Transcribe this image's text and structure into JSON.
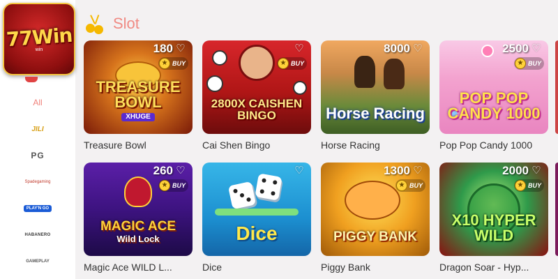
{
  "sidebar": {
    "logo_text": "77Win",
    "logo_sub": "win",
    "items": [
      {
        "label": "All",
        "name": "sidebar-item-all"
      },
      {
        "label": "JILI",
        "name": "sidebar-item-jili"
      },
      {
        "label": "PG",
        "name": "sidebar-item-pg"
      },
      {
        "label": "Spadegaming",
        "name": "sidebar-item-spadegaming"
      },
      {
        "label": "PLAY'N GO",
        "name": "sidebar-item-playngo"
      },
      {
        "label": "HABANERO",
        "name": "sidebar-item-habanero"
      },
      {
        "label": "GAMEPLAY",
        "name": "sidebar-item-gameplay"
      }
    ]
  },
  "header": {
    "title": "Slot",
    "icon": "cherry-icon"
  },
  "buy_label": "BUY",
  "games": [
    {
      "name": "Treasure Bowl",
      "count": "180",
      "art_title": "TREASURE BOWL",
      "art_sub": "XHUGE",
      "buy": true
    },
    {
      "name": "Cai Shen Bingo",
      "count": "",
      "art_title": "2800X CAISHEN BINGO",
      "art_sub": "",
      "buy": true
    },
    {
      "name": "Horse Racing",
      "count": "8000",
      "art_title": "Horse Racing",
      "art_sub": "",
      "buy": false
    },
    {
      "name": "Pop Pop Candy 1000",
      "count": "2500",
      "art_title": "POP POP CANDY 1000",
      "art_sub": "",
      "buy": true
    },
    {
      "name": "Magic Ace WILD L...",
      "count": "260",
      "art_title": "MAGIC ACE",
      "art_sub": "Wild Lock",
      "buy": true
    },
    {
      "name": "Dice",
      "count": "",
      "art_title": "Dice",
      "art_sub": "",
      "buy": false
    },
    {
      "name": "Piggy Bank",
      "count": "1300",
      "art_title": "PIGGY BANK",
      "art_sub": "",
      "buy": true
    },
    {
      "name": "Dragon Soar - Hyp...",
      "count": "2000",
      "art_title": "X10 HYPER WILD",
      "art_sub": "",
      "buy": true
    }
  ]
}
